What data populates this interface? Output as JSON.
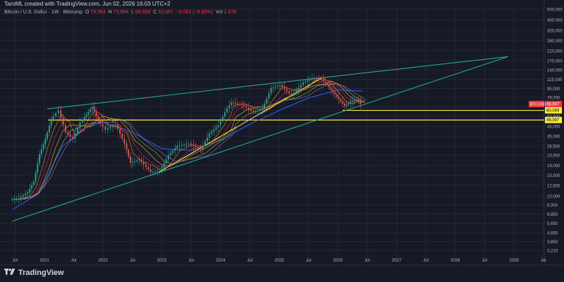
{
  "header": {
    "attribution": "TaroML created with TradingView.com, Jun 02, 2026 16:03 UTC+2"
  },
  "legend": {
    "symbol": "Bitcoin / U.S. Dollar · 1W · Bitstamp",
    "o_label": "O",
    "o": "73,568",
    "h_label": "H",
    "h": "73,984",
    "l_label": "L",
    "l": "68,550",
    "c_label": "C",
    "c": "68,567",
    "chg": "−5,001 (−6.80%)",
    "vol_label": "Vol",
    "vol": "1.07K"
  },
  "brand": {
    "name": "TradingView"
  },
  "colors": {
    "background": "#161a25",
    "channel": "#26a69a",
    "support": "#ffeb3b",
    "up": "#26a69a",
    "down": "#ef5350",
    "price_badge": "#f23645"
  },
  "chart_data": {
    "type": "line",
    "scale": "log",
    "symbol": "BTCUSD",
    "y_ticks": [
      "500,000",
      "400,000",
      "320,000",
      "260,000",
      "210,000",
      "170,000",
      "140,000",
      "115,000",
      "95,000",
      "79,000",
      "65,000",
      "53,500",
      "43,000",
      "35,000",
      "28,500",
      "23,500",
      "19,000",
      "15,500",
      "12,500",
      "10,000",
      "8,300",
      "6,850",
      "5,650",
      "4,650",
      "3,850",
      "3,210"
    ],
    "x_ticks": [
      "Jul",
      "2021",
      "Jul",
      "2022",
      "Jul",
      "2023",
      "Jul",
      "2024",
      "Jul",
      "2025",
      "Jul",
      "2026",
      "Jul",
      "2027",
      "Jul",
      "2028",
      "Jul",
      "2029",
      "Jul"
    ],
    "price_labels": [
      {
        "label": "BTCUSD",
        "value": "68,567"
      },
      {
        "label": "",
        "value": "60,059"
      },
      {
        "label": "",
        "value": "49,097"
      }
    ],
    "horizontal_levels": [
      60059,
      49097
    ],
    "price_series": [
      {
        "t": 2020.45,
        "p": 9300
      },
      {
        "t": 2020.6,
        "p": 9500
      },
      {
        "t": 2020.75,
        "p": 10800
      },
      {
        "t": 2020.85,
        "p": 13500
      },
      {
        "t": 2020.95,
        "p": 24000
      },
      {
        "t": 2021.05,
        "p": 33000
      },
      {
        "t": 2021.15,
        "p": 50000
      },
      {
        "t": 2021.28,
        "p": 60000
      },
      {
        "t": 2021.4,
        "p": 38000
      },
      {
        "t": 2021.52,
        "p": 33000
      },
      {
        "t": 2021.65,
        "p": 47000
      },
      {
        "t": 2021.75,
        "p": 55000
      },
      {
        "t": 2021.85,
        "p": 65000
      },
      {
        "t": 2021.95,
        "p": 48000
      },
      {
        "t": 2022.08,
        "p": 40000
      },
      {
        "t": 2022.25,
        "p": 45000
      },
      {
        "t": 2022.4,
        "p": 30000
      },
      {
        "t": 2022.5,
        "p": 20000
      },
      {
        "t": 2022.65,
        "p": 21500
      },
      {
        "t": 2022.85,
        "p": 16500
      },
      {
        "t": 2023.0,
        "p": 16800
      },
      {
        "t": 2023.15,
        "p": 23500
      },
      {
        "t": 2023.3,
        "p": 28500
      },
      {
        "t": 2023.5,
        "p": 30000
      },
      {
        "t": 2023.7,
        "p": 26500
      },
      {
        "t": 2023.85,
        "p": 37000
      },
      {
        "t": 2024.0,
        "p": 44000
      },
      {
        "t": 2024.15,
        "p": 63000
      },
      {
        "t": 2024.22,
        "p": 71000
      },
      {
        "t": 2024.4,
        "p": 67000
      },
      {
        "t": 2024.6,
        "p": 58000
      },
      {
        "t": 2024.75,
        "p": 62000
      },
      {
        "t": 2024.9,
        "p": 96000
      },
      {
        "t": 2025.05,
        "p": 102000
      },
      {
        "t": 2025.25,
        "p": 82000
      },
      {
        "t": 2025.45,
        "p": 108000
      },
      {
        "t": 2025.6,
        "p": 118000
      },
      {
        "t": 2025.75,
        "p": 115000
      },
      {
        "t": 2025.85,
        "p": 103000
      },
      {
        "t": 2025.95,
        "p": 88000
      },
      {
        "t": 2026.05,
        "p": 76000
      },
      {
        "t": 2026.15,
        "p": 66000
      },
      {
        "t": 2026.25,
        "p": 72000
      },
      {
        "t": 2026.35,
        "p": 76000
      },
      {
        "t": 2026.42,
        "p": 68567
      }
    ],
    "moving_average": [
      {
        "t": 2020.45,
        "p": 7500
      },
      {
        "t": 2020.9,
        "p": 10500
      },
      {
        "t": 2021.3,
        "p": 28000
      },
      {
        "t": 2021.7,
        "p": 42000
      },
      {
        "t": 2022.0,
        "p": 47000
      },
      {
        "t": 2022.5,
        "p": 38000
      },
      {
        "t": 2023.0,
        "p": 27000
      },
      {
        "t": 2023.5,
        "p": 26000
      },
      {
        "t": 2024.0,
        "p": 32000
      },
      {
        "t": 2024.5,
        "p": 45000
      },
      {
        "t": 2025.0,
        "p": 60000
      },
      {
        "t": 2025.5,
        "p": 78000
      },
      {
        "t": 2026.0,
        "p": 92000
      },
      {
        "t": 2026.42,
        "p": 90000
      }
    ],
    "channel_lines": [
      {
        "name": "upper",
        "from": {
          "t": 2021.05,
          "p": 62000
        },
        "to": {
          "t": 2028.9,
          "p": 185000
        }
      },
      {
        "name": "lower",
        "from": {
          "t": 2020.45,
          "p": 5900
        },
        "to": {
          "t": 2028.9,
          "p": 185000
        }
      }
    ],
    "trend_lines": [
      {
        "from": {
          "t": 2022.95,
          "p": 16500
        },
        "to": {
          "t": 2025.72,
          "p": 118000
        }
      }
    ]
  }
}
